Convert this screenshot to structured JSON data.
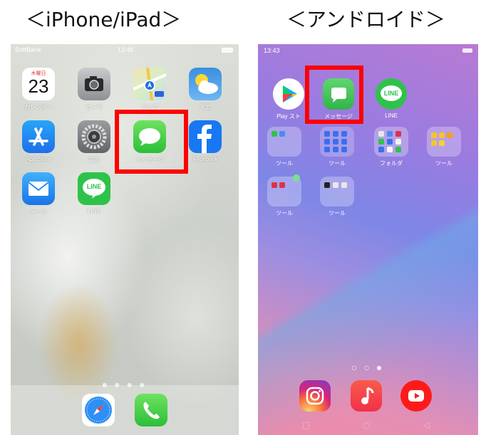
{
  "headings": {
    "ios": "＜iPhone/iPad＞",
    "android": "＜アンドロイド＞"
  },
  "iphone": {
    "status": {
      "carrier": "SoftBank",
      "time": "13:46"
    },
    "apps": [
      {
        "name": "calendar",
        "label": "カレンダー",
        "day": "木曜日",
        "date": "23"
      },
      {
        "name": "camera",
        "label": "カメラ"
      },
      {
        "name": "maps",
        "label": "マップ"
      },
      {
        "name": "weather",
        "label": "天気"
      },
      {
        "name": "app-store",
        "label": "App Store"
      },
      {
        "name": "settings",
        "label": "設定"
      },
      {
        "name": "messages",
        "label": "メッセージ"
      },
      {
        "name": "facebook",
        "label": "Facebook"
      },
      {
        "name": "mail",
        "label": "メール"
      },
      {
        "name": "line",
        "label": "LINE",
        "badge": "LINE"
      }
    ],
    "dock": [
      "safari",
      "phone"
    ],
    "highlight_color": "#ff0000"
  },
  "android": {
    "status": {
      "time": "13:43"
    },
    "apps": [
      {
        "name": "play-store",
        "label": "Play スト"
      },
      {
        "name": "messages",
        "label": "メッセージ"
      },
      {
        "name": "line",
        "label": "LINE",
        "badge": "LINE"
      }
    ],
    "folders": [
      {
        "label": "ツール"
      },
      {
        "label": "ツール"
      },
      {
        "label": "フォルダ"
      },
      {
        "label": "ツール"
      },
      {
        "label": "ツール"
      },
      {
        "label": "ツール"
      }
    ],
    "dock": [
      "instagram",
      "music",
      "youtube"
    ],
    "highlight_color": "#ff0000"
  }
}
